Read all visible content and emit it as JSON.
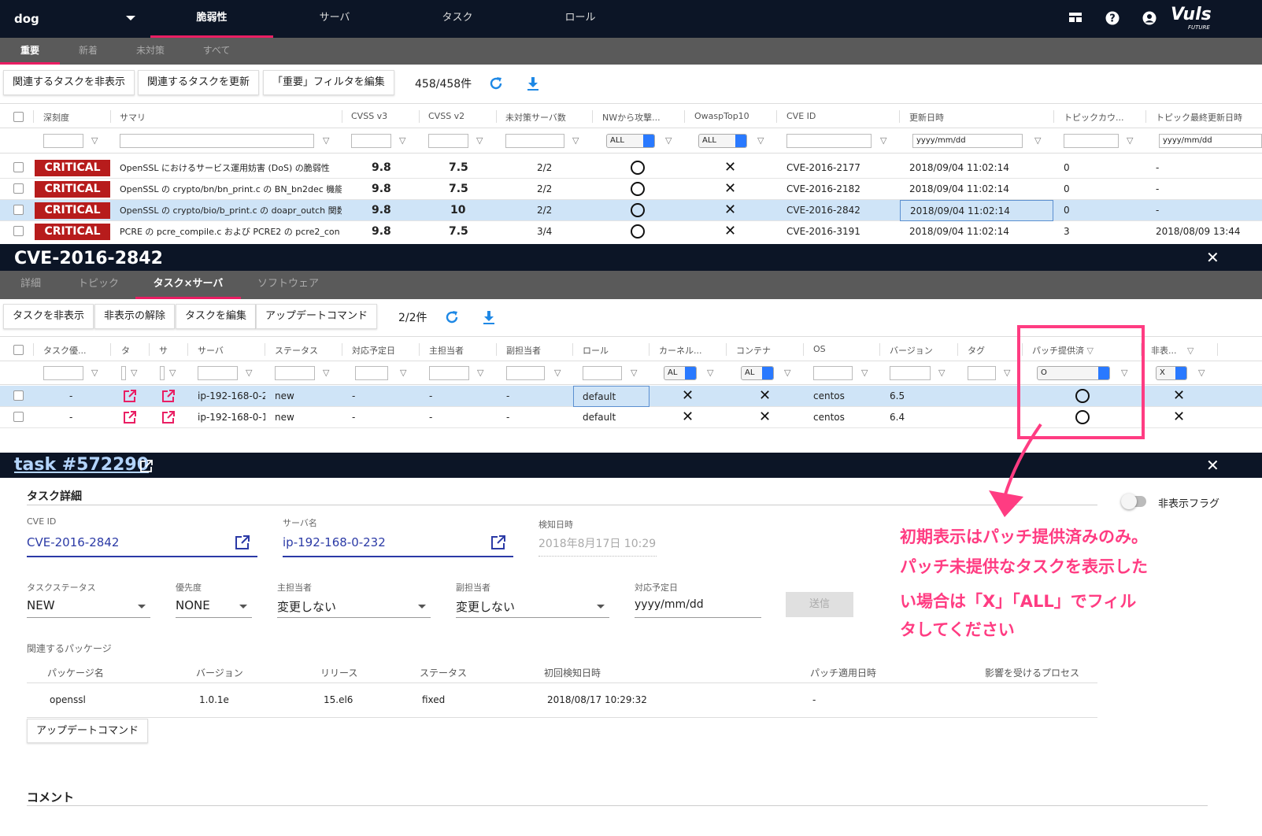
{
  "topbar": {
    "env": "dog",
    "tabs": [
      "脆弱性",
      "サーバ",
      "タスク",
      "ロール"
    ],
    "brand": "Vuls",
    "brand_sub": "FUTURE"
  },
  "subtabs": [
    "重要",
    "新着",
    "未対策",
    "すべて"
  ],
  "toolbar": {
    "hide": "関連するタスクを非表示",
    "update": "関連するタスクを更新",
    "edit_filter": "「重要」フィルタを編集",
    "count": "458/458件"
  },
  "vuln_table": {
    "columns": [
      "深刻度",
      "サマリ",
      "CVSS v3",
      "CVSS v2",
      "未対策サーバ数",
      "NWから攻撃...",
      "OwaspTop10",
      "CVE ID",
      "更新日時",
      "トピックカウ...",
      "トピック最終更新日時"
    ],
    "filter_all": "ALL",
    "date_placeholder": "yyyy/mm/dd",
    "rows": [
      {
        "sev": "CRITICAL",
        "summary": "OpenSSL におけるサービス運用妨害 (DoS) の脆弱性",
        "v3": "9.8",
        "v2": "7.5",
        "servers": "2/2",
        "cve": "CVE-2016-2177",
        "updated": "2018/09/04 11:02:14",
        "topic": "0",
        "last": "-"
      },
      {
        "sev": "CRITICAL",
        "summary": "OpenSSL の crypto/bn/bn_print.c の BN_bn2dec 機能",
        "v3": "9.8",
        "v2": "7.5",
        "servers": "2/2",
        "cve": "CVE-2016-2182",
        "updated": "2018/09/04 11:02:14",
        "topic": "0",
        "last": "-"
      },
      {
        "sev": "CRITICAL",
        "summary": "OpenSSL の crypto/bio/b_print.c の doapr_outch 関数",
        "v3": "9.8",
        "v2": "10",
        "servers": "2/2",
        "cve": "CVE-2016-2842",
        "updated": "2018/09/04 11:02:14",
        "topic": "0",
        "last": "-"
      },
      {
        "sev": "CRITICAL",
        "summary": "PCRE の pcre_compile.c および PCRE2 の pcre2_con",
        "v3": "9.8",
        "v2": "7.5",
        "servers": "3/4",
        "cve": "CVE-2016-3191",
        "updated": "2018/09/04 11:02:14",
        "topic": "3",
        "last": "2018/08/09 13:44"
      }
    ]
  },
  "cve_panel": {
    "title": "CVE-2016-2842",
    "tabs": [
      "詳細",
      "トピック",
      "タスク×サーバ",
      "ソフトウェア"
    ],
    "toolbar": {
      "hide": "タスクを非表示",
      "unhide": "非表示の解除",
      "edit": "タスクを編集",
      "cmd": "アップデートコマンド",
      "count": "2/2件"
    },
    "columns": [
      "タスク優...",
      "タ",
      "サ",
      "サーバ",
      "ステータス",
      "対応予定日",
      "主担当者",
      "副担当者",
      "ロール",
      "カーネル...",
      "コンテナ",
      "OS",
      "バージョン",
      "タグ",
      "パッチ提供済",
      "非表..."
    ],
    "filter_al": "AL",
    "filter_o": "O",
    "filter_x": "X",
    "rows": [
      {
        "prio": "-",
        "server": "ip-192-168-0-2",
        "status": "new",
        "due": "-",
        "main": "-",
        "sub": "-",
        "role": "default",
        "os": "centos",
        "ver": "6.5"
      },
      {
        "prio": "-",
        "server": "ip-192-168-0-1",
        "status": "new",
        "due": "-",
        "main": "-",
        "sub": "-",
        "role": "default",
        "os": "centos",
        "ver": "6.4"
      }
    ]
  },
  "task_panel": {
    "title": "task #572290",
    "section": "タスク詳細",
    "hidden_flag": "非表示フラグ",
    "cve_label": "CVE ID",
    "cve": "CVE-2016-2842",
    "server_label": "サーバ名",
    "server": "ip-192-168-0-232",
    "detect_label": "検知日時",
    "detect": "2018年8月17日 10:29",
    "status_label": "タスクステータス",
    "status": "NEW",
    "prio_label": "優先度",
    "prio": "NONE",
    "main_label": "主担当者",
    "main": "変更しない",
    "sub_label": "副担当者",
    "sub": "変更しない",
    "due_label": "対応予定日",
    "due": "yyyy/mm/dd",
    "send": "送信",
    "pkg_label": "関連するパッケージ",
    "pkg_cols": [
      "パッケージ名",
      "バージョン",
      "リリース",
      "ステータス",
      "初回検知日時",
      "パッチ適用日時",
      "影響を受けるプロセス"
    ],
    "pkg_row": [
      "openssl",
      "1.0.1e",
      "15.el6",
      "fixed",
      "2018/08/17 10:29:32",
      "-",
      ""
    ],
    "cmd": "アップデートコマンド",
    "comment": "コメント"
  },
  "annotation": {
    "lines": [
      "初期表示はパッチ提供済みのみ。",
      "パッチ未提供なタスクを表示した",
      "い場合は「X」「ALL」でフィル",
      "タしてください"
    ],
    "color": "#ff3c82"
  }
}
